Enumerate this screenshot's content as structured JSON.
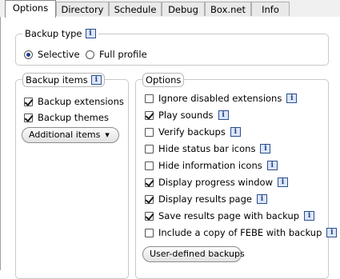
{
  "tabs": [
    {
      "label": "Options",
      "active": true
    },
    {
      "label": "Directory"
    },
    {
      "label": "Schedule"
    },
    {
      "label": "Debug"
    },
    {
      "label": "Box.net"
    },
    {
      "label": "Info"
    }
  ],
  "backup_type": {
    "legend": "Backup type",
    "options": [
      {
        "label": "Selective",
        "selected": true
      },
      {
        "label": "Full profile",
        "selected": false
      }
    ]
  },
  "backup_items": {
    "legend": "Backup items",
    "items": [
      {
        "label": "Backup extensions",
        "checked": true
      },
      {
        "label": "Backup themes",
        "checked": true
      }
    ],
    "dropdown_label": "Additional items"
  },
  "options": {
    "legend": "Options",
    "items": [
      {
        "label": "Ignore disabled extensions",
        "checked": false
      },
      {
        "label": "Play sounds",
        "checked": true
      },
      {
        "label": "Verify backups",
        "checked": false
      },
      {
        "label": "Hide status bar icons",
        "checked": false
      },
      {
        "label": "Hide information icons",
        "checked": false
      },
      {
        "label": "Display progress window",
        "checked": true
      },
      {
        "label": "Display results page",
        "checked": true
      },
      {
        "label": "Save results page with backup",
        "checked": true
      },
      {
        "label": "Include a copy of FEBE with backup",
        "checked": false
      }
    ],
    "button_label": "User-defined backups"
  },
  "info_glyph": "i"
}
